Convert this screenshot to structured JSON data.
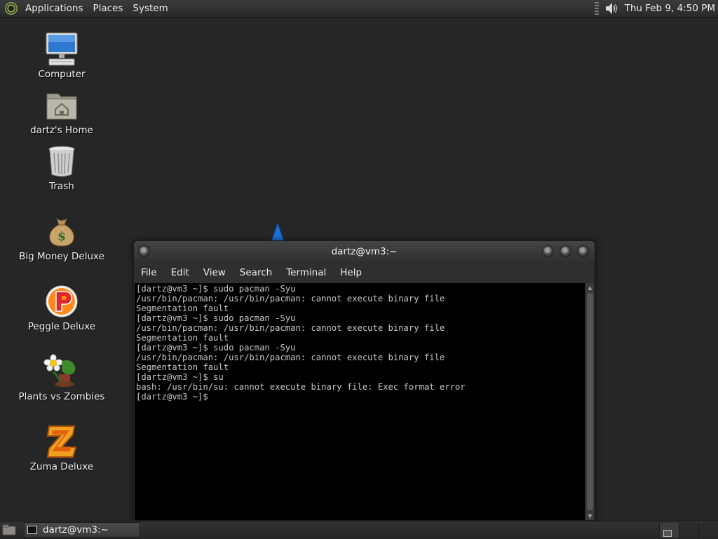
{
  "top_panel": {
    "menus": [
      "Applications",
      "Places",
      "System"
    ],
    "clock": "Thu Feb  9,  4:50 PM"
  },
  "desktop": {
    "icons": [
      {
        "label": "Computer",
        "icon": "computer-icon"
      },
      {
        "label": "dartz's Home",
        "icon": "home-folder-icon"
      },
      {
        "label": "Trash",
        "icon": "trash-icon"
      },
      {
        "label": "Big Money Deluxe",
        "icon": "money-bag-icon"
      },
      {
        "label": "Peggle Deluxe",
        "icon": "peggle-icon"
      },
      {
        "label": "Plants vs Zombies",
        "icon": "plants-vs-zombies-icon"
      },
      {
        "label": "Zuma Deluxe",
        "icon": "zuma-icon"
      }
    ]
  },
  "terminal": {
    "title": "dartz@vm3:~",
    "menu": [
      "File",
      "Edit",
      "View",
      "Search",
      "Terminal",
      "Help"
    ],
    "lines": [
      "[dartz@vm3 ~]$ sudo pacman -Syu",
      "/usr/bin/pacman: /usr/bin/pacman: cannot execute binary file",
      "Segmentation fault",
      "[dartz@vm3 ~]$ sudo pacman -Syu",
      "/usr/bin/pacman: /usr/bin/pacman: cannot execute binary file",
      "Segmentation fault",
      "[dartz@vm3 ~]$ sudo pacman -Syu",
      "/usr/bin/pacman: /usr/bin/pacman: cannot execute binary file",
      "Segmentation fault",
      "[dartz@vm3 ~]$ su",
      "bash: /usr/bin/su: cannot execute binary file: Exec format error",
      "[dartz@vm3 ~]$"
    ]
  },
  "bottom_panel": {
    "task_label": "dartz@vm3:~"
  },
  "colors": {
    "desktop_bg": "#262626",
    "terminal_bg": "#000000",
    "terminal_fg": "#c8c8c8"
  }
}
